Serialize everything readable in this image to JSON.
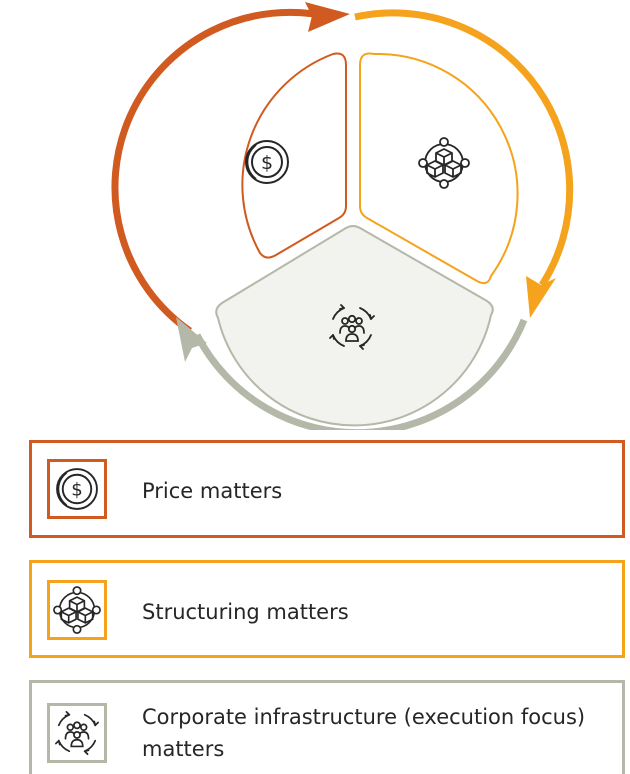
{
  "colors": {
    "price": "#d05a1f",
    "structuring": "#f5a21c",
    "infrastructure": "#b4b8a8",
    "icon_stroke": "#262626"
  },
  "cycle": {
    "segments": [
      {
        "icon": "dollar-coin-icon"
      },
      {
        "icon": "blockchain-cubes-icon"
      },
      {
        "icon": "team-cycle-icon"
      }
    ]
  },
  "legend": {
    "items": [
      {
        "icon": "dollar-coin-icon",
        "label": "Price matters"
      },
      {
        "icon": "blockchain-cubes-icon",
        "label": "Structuring matters"
      },
      {
        "icon": "team-cycle-icon",
        "label": "Corporate infrastructure (execution focus) matters"
      }
    ]
  }
}
